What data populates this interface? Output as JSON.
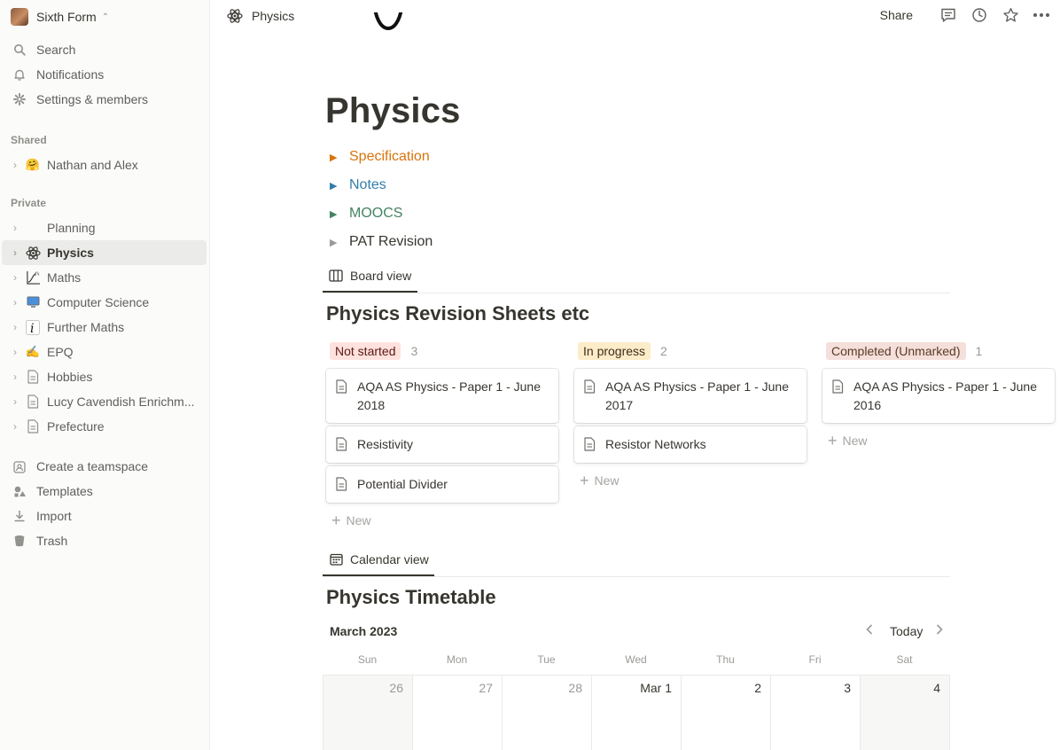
{
  "workspace": {
    "name": "Sixth Form"
  },
  "sidebar": {
    "nav": [
      {
        "label": "Search",
        "icon": "search-icon"
      },
      {
        "label": "Notifications",
        "icon": "bell-icon"
      },
      {
        "label": "Settings & members",
        "icon": "gear-icon"
      }
    ],
    "shared_label": "Shared",
    "shared_items": [
      {
        "label": "Nathan and Alex",
        "icon": "hugging-face-emoji"
      }
    ],
    "private_label": "Private",
    "private_items": [
      {
        "label": "Planning",
        "icon": "blank-icon"
      },
      {
        "label": "Physics",
        "icon": "atom-icon",
        "active": true
      },
      {
        "label": "Maths",
        "icon": "function-graph-icon"
      },
      {
        "label": "Computer Science",
        "icon": "computer-emoji"
      },
      {
        "label": "Further Maths",
        "icon": "info-letter-icon"
      },
      {
        "label": "EPQ",
        "icon": "writing-hand-emoji"
      },
      {
        "label": "Hobbies",
        "icon": "page-icon"
      },
      {
        "label": "Lucy Cavendish Enrichm...",
        "icon": "page-icon"
      },
      {
        "label": "Prefecture",
        "icon": "page-icon"
      }
    ],
    "footer": [
      {
        "label": "Create a teamspace",
        "icon": "teamspace-icon"
      },
      {
        "label": "Templates",
        "icon": "templates-icon"
      },
      {
        "label": "Import",
        "icon": "import-icon"
      },
      {
        "label": "Trash",
        "icon": "trash-icon"
      }
    ]
  },
  "topbar": {
    "breadcrumb": "Physics",
    "share_label": "Share"
  },
  "page": {
    "title": "Physics",
    "toggles": [
      {
        "label": "Specification",
        "color": "#d9730d"
      },
      {
        "label": "Notes",
        "color": "#337ea9"
      },
      {
        "label": "MOOCS",
        "color": "#448361"
      },
      {
        "label": "PAT Revision",
        "color": "#37352f"
      }
    ]
  },
  "board": {
    "view_label": "Board view",
    "title": "Physics Revision Sheets etc",
    "new_label": "New",
    "columns": [
      {
        "status": "Not started",
        "count": "3",
        "tag_bg": "#ffe2dd",
        "tag_color": "#5d1715",
        "cards": [
          "AQA AS Physics - Paper 1 - June 2018",
          "Resistivity",
          "Potential Divider"
        ]
      },
      {
        "status": "In progress",
        "count": "2",
        "tag_bg": "#fdecc8",
        "tag_color": "#402c1b",
        "cards": [
          "AQA AS Physics - Paper 1 - June 2017",
          "Resistor Networks"
        ]
      },
      {
        "status": "Completed (Unmarked)",
        "count": "1",
        "tag_bg": "#f4dfdb",
        "tag_color": "#5c3b23",
        "cards": [
          "AQA AS Physics - Paper 1 - June 2016"
        ]
      }
    ]
  },
  "calendar": {
    "view_label": "Calendar view",
    "title": "Physics Timetable",
    "month": "March 2023",
    "today_label": "Today",
    "weekdays": [
      "Sun",
      "Mon",
      "Tue",
      "Wed",
      "Thu",
      "Fri",
      "Sat"
    ],
    "days": [
      "26",
      "27",
      "28",
      "Mar 1",
      "2",
      "3",
      "4"
    ]
  }
}
